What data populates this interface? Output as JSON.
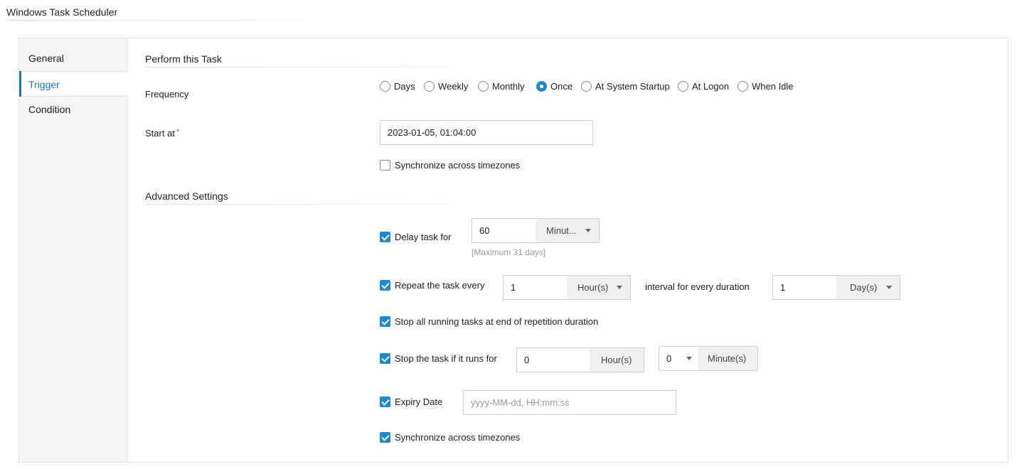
{
  "app": {
    "title": "Windows Task Scheduler"
  },
  "sidebar": {
    "items": [
      {
        "label": "General",
        "active": false
      },
      {
        "label": "Trigger",
        "active": true
      },
      {
        "label": "Condition",
        "active": false
      }
    ]
  },
  "perform": {
    "section_title": "Perform this Task",
    "frequency_label": "Frequency",
    "frequency_options": [
      "Days",
      "Weekly",
      "Monthly",
      "Once",
      "At System Startup",
      "At Logon",
      "When Idle"
    ],
    "frequency_selected": "Once",
    "start_at_label": "Start at",
    "start_at_required": "*",
    "start_at_value": "2023-01-05, 01:04:00",
    "sync_label": "Synchronize across timezones",
    "sync_checked": false
  },
  "advanced": {
    "section_title": "Advanced Settings",
    "delay": {
      "label": "Delay task for",
      "checked": true,
      "value": "60",
      "unit": "Minut...",
      "hint": "[Maximum 31 days]"
    },
    "repeat": {
      "label": "Repeat the task every",
      "checked": true,
      "value": "1",
      "unit": "Hour(s)",
      "interval_label": "interval for every duration",
      "duration_value": "1",
      "duration_unit": "Day(s)"
    },
    "stop_all": {
      "label": "Stop all running tasks at end of repetition duration",
      "checked": true
    },
    "stop_runs": {
      "label": "Stop the task if it runs for",
      "checked": true,
      "hours_value": "0",
      "hours_unit": "Hour(s)",
      "minutes_value": "0",
      "minutes_unit": "Minute(s)"
    },
    "expiry": {
      "label": "Expiry Date",
      "checked": true,
      "placeholder": "yyyy-MM-dd, HH:mm:ss"
    },
    "sync": {
      "label": "Synchronize across timezones",
      "checked": true
    }
  },
  "colors": {
    "accent": "#1a8ad4",
    "active_nav": "#1e7ab8",
    "required": "#e0474c"
  }
}
